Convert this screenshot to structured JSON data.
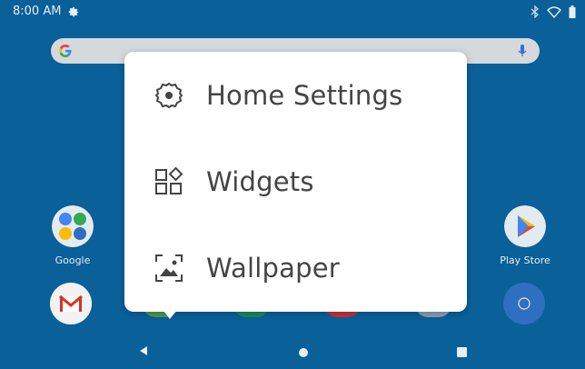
{
  "status_bar": {
    "time": "8:00 AM"
  },
  "apps": [
    {
      "label": "Google"
    },
    {
      "label": "Play Store"
    }
  ],
  "menu": {
    "items": [
      {
        "label": "Home Settings",
        "icon": "gear-icon"
      },
      {
        "label": "Widgets",
        "icon": "widgets-icon"
      },
      {
        "label": "Wallpaper",
        "icon": "wallpaper-icon"
      }
    ]
  },
  "colors": {
    "wallpaper": "#0a6099",
    "menu_background": "#ffffff",
    "menu_text": "#444444",
    "search_bar": "#d5d9dc"
  }
}
